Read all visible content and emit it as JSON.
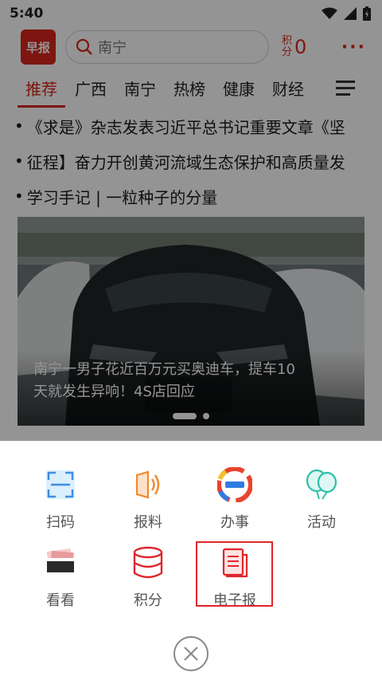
{
  "status_bar": {
    "time": "5:40"
  },
  "header": {
    "logo": "早报",
    "search_text": "南宁",
    "points_label": "积分",
    "points_value": "0",
    "more": "···"
  },
  "tabs": [
    {
      "label": "推荐",
      "active": true
    },
    {
      "label": "广西"
    },
    {
      "label": "南宁"
    },
    {
      "label": "热榜"
    },
    {
      "label": "健康"
    },
    {
      "label": "财经"
    }
  ],
  "headlines": [
    "《求是》杂志发表习近平总书记重要文章《坚",
    "征程】奋力开创黄河流域生态保护和高质量发",
    "学习手记 | 一粒种子的分量"
  ],
  "hero": {
    "caption_line1": "南宁一男子花近百万元买奥迪车，提车10",
    "caption_line2": "天就发生异响！4S店回应"
  },
  "sheet": {
    "items": [
      {
        "label": "扫码",
        "icon": "scan-icon"
      },
      {
        "label": "报料",
        "icon": "report-icon"
      },
      {
        "label": "办事",
        "icon": "service-logo-icon"
      },
      {
        "label": "活动",
        "icon": "balloon-icon"
      },
      {
        "label": "看看",
        "icon": "watch-icon"
      },
      {
        "label": "积分",
        "icon": "points-database-icon"
      },
      {
        "label": "电子报",
        "icon": "epaper-icon"
      }
    ]
  },
  "colors": {
    "brand": "#d8261c",
    "highlight": "#e0262b",
    "sheet_bg": "#ffffff"
  }
}
